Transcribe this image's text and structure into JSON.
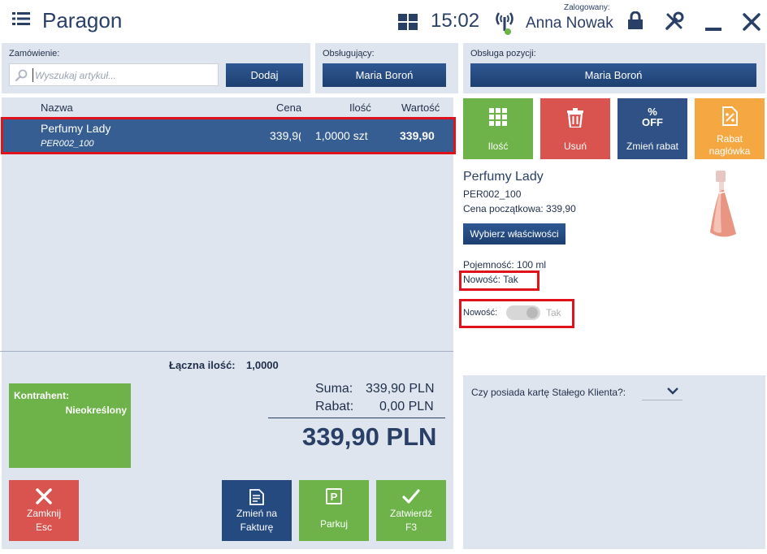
{
  "header": {
    "title": "Paragon",
    "time": "15:02",
    "logged_label": "Zalogowany:",
    "user": "Anna Nowak"
  },
  "order": {
    "label": "Zamówienie:",
    "search_placeholder": "Wyszukaj artykuł...",
    "add_button": "Dodaj"
  },
  "served_by": {
    "label": "Obsługujący:",
    "value": "Maria Boroń"
  },
  "position_service": {
    "label": "Obsługa pozycji:",
    "value": "Maria Boroń"
  },
  "table": {
    "headers": {
      "name": "Nazwa",
      "price": "Cena",
      "qty": "Ilość",
      "value": "Wartość"
    },
    "rows": [
      {
        "name": "Perfumy Lady",
        "code": "PER002_100",
        "price": "339,9(",
        "qty": "1,0000 szt",
        "value": "339,90"
      }
    ],
    "total_qty_label": "Łączna ilość:",
    "total_qty": "1,0000"
  },
  "actions": {
    "qty": "Ilość",
    "delete": "Usuń",
    "change_discount": "Zmień rabat",
    "off_line1": "%",
    "off_line2": "OFF",
    "header_discount_1": "Rabat",
    "header_discount_2": "nagłówka"
  },
  "product": {
    "name": "Perfumy Lady",
    "code": "PER002_100",
    "initial_price": "Cena początkowa: 339,90",
    "choose_props": "Wybierz właściwości",
    "capacity": "Pojemność: 100 ml",
    "novelty": "Nowość: Tak",
    "novelty_toggle_label": "Nowość:",
    "novelty_toggle_value": "Tak"
  },
  "contractor": {
    "label": "Kontrahent:",
    "value": "Nieokreślony"
  },
  "summary": {
    "sum_label": "Suma:",
    "sum_value": "339,90 PLN",
    "discount_label": "Rabat:",
    "discount_value": "0,00 PLN",
    "total": "339,90 PLN"
  },
  "bottom_buttons": {
    "close_1": "Zamknij",
    "close_2": "Esc",
    "invoice_1": "Zmień na",
    "invoice_2": "Fakturę",
    "park": "Parkuj",
    "park_icon_letter": "P",
    "confirm_1": "Zatwierdź",
    "confirm_2": "F3"
  },
  "loyalty": {
    "question": "Czy posiada kartę Stałego Klienta?:"
  },
  "colors": {
    "navy": "#2a3f66",
    "selected_row": "#375e93",
    "green": "#6db34a",
    "red": "#d9534f",
    "orange": "#f5a742",
    "panel": "#dfe5ee",
    "highlight": "#e0121b"
  }
}
